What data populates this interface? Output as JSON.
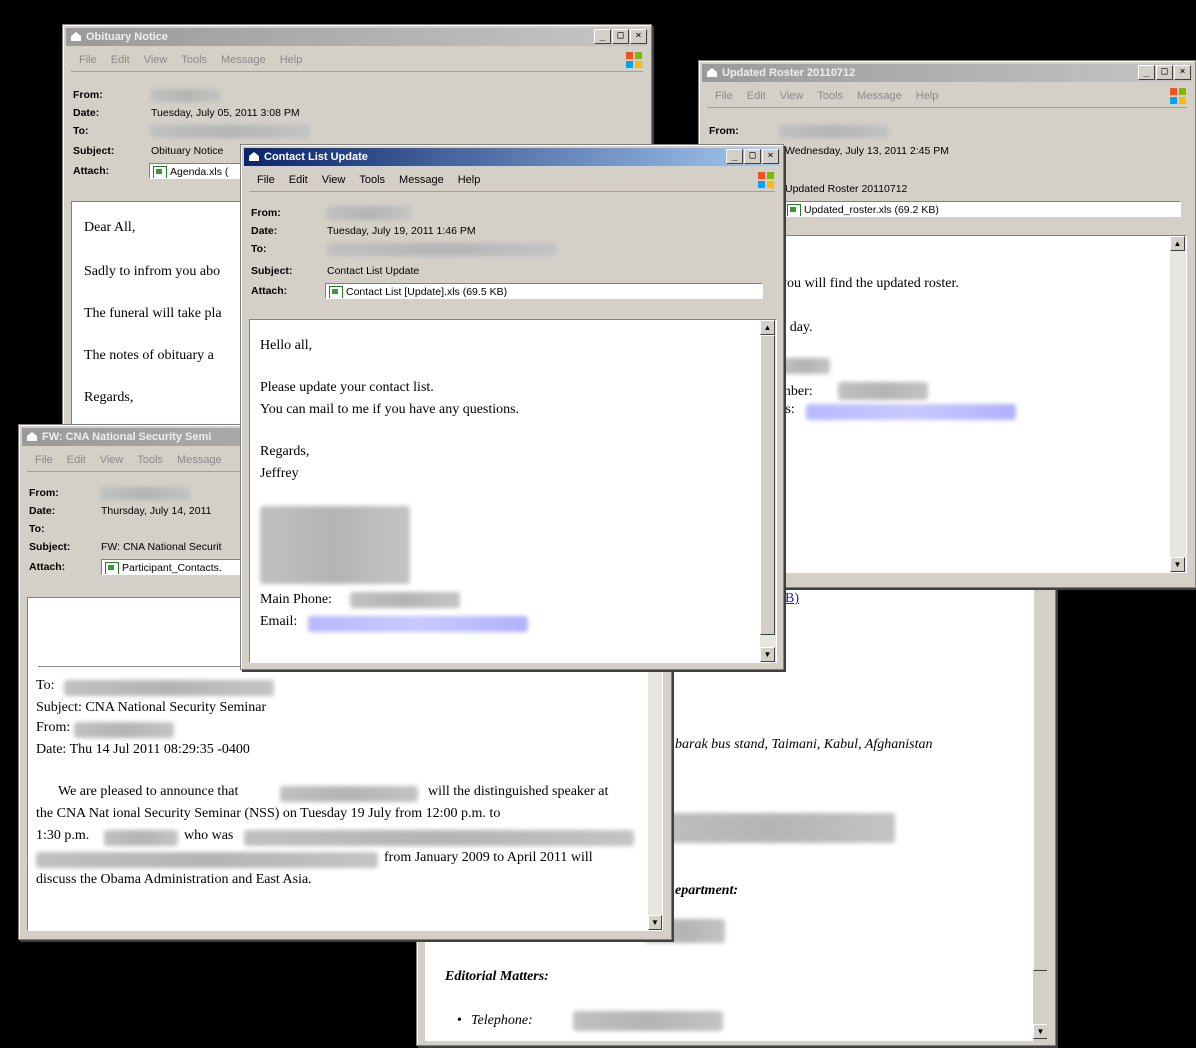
{
  "menu": {
    "file": "File",
    "edit": "Edit",
    "view": "View",
    "tools": "Tools",
    "message": "Message",
    "help": "Help"
  },
  "labels": {
    "from": "From:",
    "date": "Date:",
    "to": "To:",
    "subject": "Subject:",
    "attach": "Attach:"
  },
  "window_controls": {
    "minimize": "_",
    "maximize": "□",
    "close": "×"
  },
  "obituary": {
    "title": "Obituary Notice",
    "date": "Tuesday, July 05, 2011 3:08 PM",
    "subject": "Obituary Notice",
    "attachment": "Agenda.xls (",
    "body": [
      "Dear All,",
      "Sadly to infrom you abo",
      "The funeral will take pla",
      "The notes of obituary a",
      "Regards,"
    ]
  },
  "roster": {
    "title": "Updated Roster 20110712",
    "date": "Wednesday, July 13, 2011 2:45 PM",
    "subject": "Updated Roster 20110712",
    "attachment": "Updated_roster.xls (69.2 KB)",
    "body": [
      "you will find the updated roster.",
      "e day.",
      "mber:",
      "ss:"
    ]
  },
  "cna": {
    "title": "FW: CNA National Security Semi",
    "date": "Thursday, July 14, 2011 ",
    "subject": "FW: CNA National Securit",
    "attachment": "Participant_Contacts.",
    "body": [
      "To:",
      "Subject: CNA National Security Seminar",
      "From:",
      "Date: Thu 14 Jul 2011 08:29:35 -0400",
      "We are pleased to announce that",
      "will the distinguished speaker at",
      "the CNA Nat ional Security Seminar (NSS) on Tuesday 19 July   from 12:00 p.m. to",
      "1:30 p.m.",
      "who was",
      "from January 2009 to April 2011 will",
      "discuss the Obama Administration and East Asia."
    ]
  },
  "back_doc": {
    "link": "B)",
    "address": "barak bus stand, Taimani, Kabul, Afghanistan",
    "department": "epartment:",
    "editorial": "Editorial Matters:",
    "telephone": "Telephone:"
  },
  "contact": {
    "title": "Contact List Update",
    "date": "Tuesday, July 19, 2011 1:46 PM",
    "subject": "Contact List Update",
    "attachment": "Contact List [Update].xls (69.5 KB)",
    "body": [
      "Hello all,",
      "Please update your contact list.",
      "You can mail to me if you have any questions.",
      "Regards,",
      "Jeffrey",
      "Main Phone:",
      "Email:"
    ]
  },
  "colors": {
    "active_title_start": "#0a246a",
    "active_title_end": "#a6caf0",
    "inactive_title": "#9a9a9a",
    "chrome": "#d4d0c8"
  }
}
